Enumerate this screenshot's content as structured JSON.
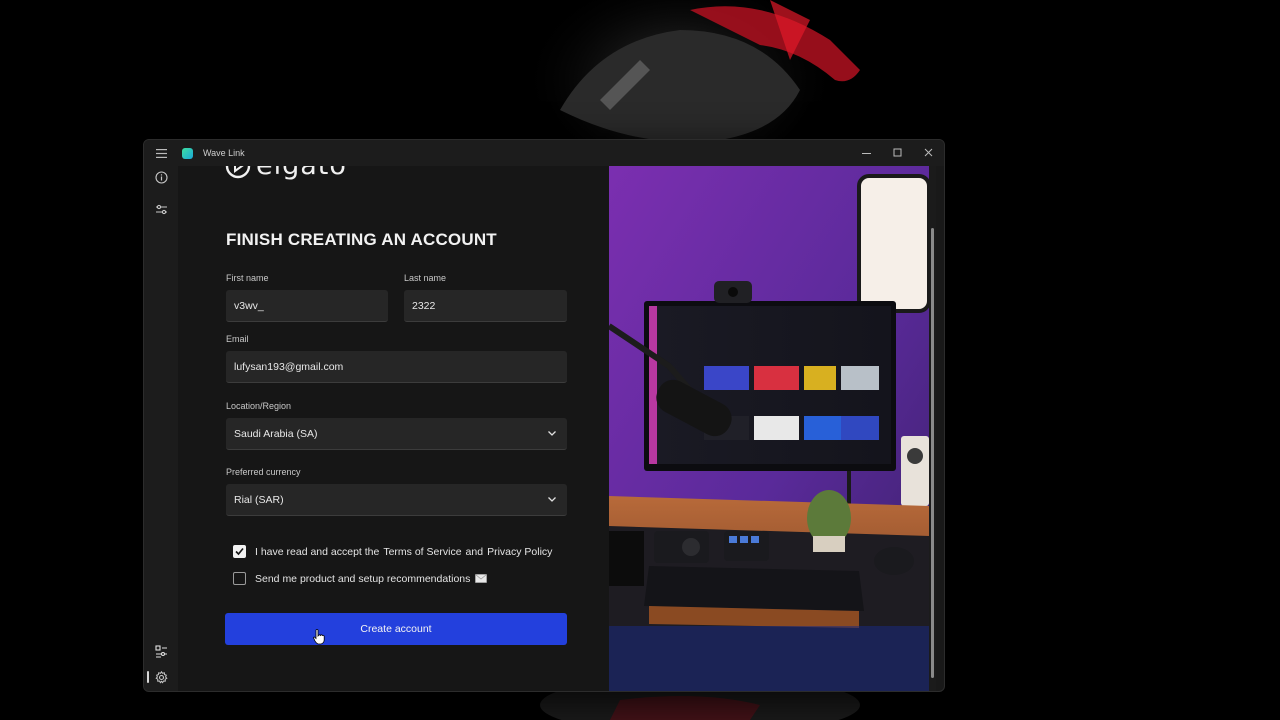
{
  "window": {
    "title": "Wave Link"
  },
  "brand": {
    "logo_text": "elgato"
  },
  "form": {
    "title": "FINISH CREATING AN ACCOUNT",
    "first_name": {
      "label": "First name",
      "value": "v3wv_"
    },
    "last_name": {
      "label": "Last name",
      "value": "2322"
    },
    "email": {
      "label": "Email",
      "value": "lufysan193@gmail.com"
    },
    "location": {
      "label": "Location/Region",
      "value": "Saudi Arabia (SA)"
    },
    "currency": {
      "label": "Preferred currency",
      "value": "Rial (SAR)"
    },
    "terms": {
      "checked": true,
      "prefix": "I have read and accept the",
      "tos_link": "Terms of Service",
      "and": "and",
      "privacy_link": "Privacy Policy"
    },
    "recommendations": {
      "checked": false,
      "text": "Send me product and setup recommendations"
    },
    "submit_label": "Create account"
  },
  "colors": {
    "accent": "#2340dd",
    "window_bg": "#191919",
    "field_bg": "#262626"
  },
  "icons": {
    "menu": "hamburger-icon",
    "info": "info-icon",
    "mixer": "sliders-icon",
    "layout": "grid-sliders-icon",
    "settings": "gear-icon",
    "dropdown": "chevron-down-icon",
    "email_emoji": "envelope-icon"
  }
}
